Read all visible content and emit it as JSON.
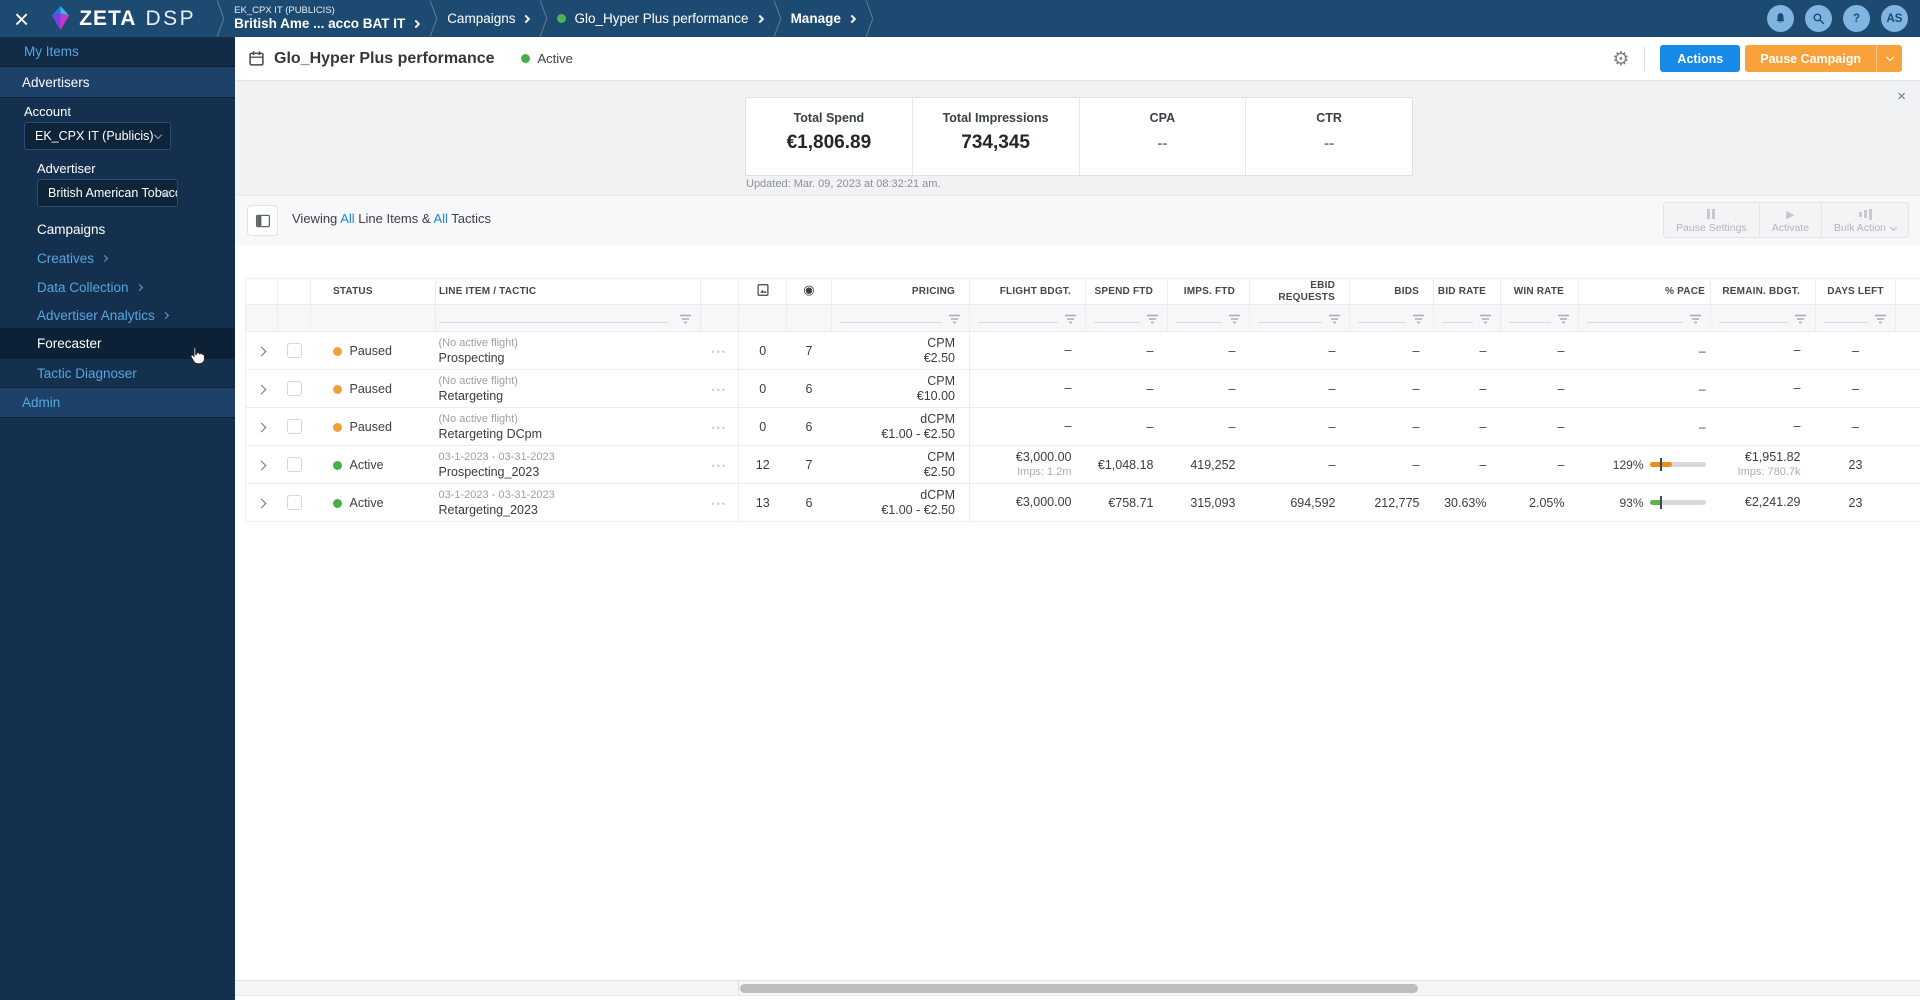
{
  "colors": {
    "accent_blue": "#1789e6",
    "accent_orange": "#f9a23b",
    "active_green": "#45b049",
    "paused_orange": "#f0a13e",
    "navbar_navy": "#1d4a70"
  },
  "status_colors": {
    "paused": "#f0a13e",
    "active": "#45b049"
  },
  "icons": {
    "dots": "•••",
    "gear": "⚙",
    "play": "▶",
    "target": "◉",
    "close": "×",
    "banner_close": "×",
    "help": "?"
  },
  "navbar": {
    "brand": {
      "zeta": "ZETA",
      "dsp": "DSP"
    },
    "breadcrumbs": [
      {
        "eyebrow": "EK_CPX IT (PUBLICIS)",
        "label": "British Ame ... acco BAT IT"
      },
      {
        "label": "Campaigns"
      },
      {
        "label": "Glo_Hyper Plus performance"
      },
      {
        "label": "Manage"
      }
    ],
    "avatar": "AS"
  },
  "sidebar": {
    "my_items": "My Items",
    "advertisers": "Advertisers",
    "account_label": "Account",
    "account_value": "EK_CPX IT (Publicis)",
    "advertiser_label": "Advertiser",
    "advertiser_value": "British American Tobacco B...",
    "campaigns": "Campaigns",
    "creatives": "Creatives",
    "data_collection": "Data Collection",
    "advertiser_analytics": "Advertiser Analytics",
    "forecaster": "Forecaster",
    "tactic_diagnoser": "Tactic Diagnoser",
    "admin": "Admin"
  },
  "header": {
    "title": "Glo_Hyper Plus performance",
    "status": "Active",
    "actions": "Actions",
    "pause_campaign": "Pause Campaign"
  },
  "stats": {
    "items": [
      {
        "label": "Total Spend",
        "value": "€1,806.89"
      },
      {
        "label": "Total Impressions",
        "value": "734,345"
      },
      {
        "label": "CPA",
        "value": "--"
      },
      {
        "label": "CTR",
        "value": "--"
      }
    ],
    "updated": "Updated: Mar. 09, 2023 at 08:32:21 am."
  },
  "toolbar": {
    "viewing_prefix": "Viewing",
    "all_1": "All",
    "mid": "Line Items &",
    "all_2": "All",
    "suffix": "Tactics",
    "pause_settings": "Pause Settings",
    "activate": "Activate",
    "bulk_action": "Bulk Action"
  },
  "table": {
    "headers": {
      "status": "STATUS",
      "line_item": "LINE ITEM / TACTIC",
      "pricing": "PRICING",
      "flight_bdgt": "FLIGHT BDGT.",
      "spend_ftd": "SPEND FTD",
      "imps_ftd": "IMPS. FTD",
      "ebid_requests": "EBID REQUESTS",
      "bids": "BIDS",
      "bid_rate": "BID RATE",
      "win_rate": "WIN RATE",
      "pace": "% PACE",
      "remain_bdgt": "REMAIN. BDGT.",
      "days_left": "DAYS LEFT"
    },
    "icon_columns": [
      "creative-image-icon",
      "tactic-target-icon"
    ],
    "rows": [
      {
        "state": "paused",
        "status": "Paused",
        "flight": "(No active flight)",
        "name": "Prospecting",
        "creatives": "0",
        "tactics": "7",
        "pricing_type": "CPM",
        "pricing_value": "€2.50",
        "flight_bdgt": "–",
        "flight_bdgt_sub": "",
        "spend_ftd": "–",
        "imps_ftd": "–",
        "ebid_requests": "–",
        "bids": "–",
        "bid_rate": "–",
        "win_rate": "–",
        "pace": "–",
        "pace_fill": 0,
        "pace_color": "",
        "remain_bdgt": "–",
        "remain_bdgt_sub": "",
        "days_left": "–"
      },
      {
        "state": "paused",
        "status": "Paused",
        "flight": "(No active flight)",
        "name": "Retargeting",
        "creatives": "0",
        "tactics": "6",
        "pricing_type": "CPM",
        "pricing_value": "€10.00",
        "flight_bdgt": "–",
        "flight_bdgt_sub": "",
        "spend_ftd": "–",
        "imps_ftd": "–",
        "ebid_requests": "–",
        "bids": "–",
        "bid_rate": "–",
        "win_rate": "–",
        "pace": "–",
        "pace_fill": 0,
        "pace_color": "",
        "remain_bdgt": "–",
        "remain_bdgt_sub": "",
        "days_left": "–"
      },
      {
        "state": "paused",
        "status": "Paused",
        "flight": "(No active flight)",
        "name": "Retargeting DCpm",
        "creatives": "0",
        "tactics": "6",
        "pricing_type": "dCPM",
        "pricing_value": "€1.00 - €2.50",
        "flight_bdgt": "–",
        "flight_bdgt_sub": "",
        "spend_ftd": "–",
        "imps_ftd": "–",
        "ebid_requests": "–",
        "bids": "–",
        "bid_rate": "–",
        "win_rate": "–",
        "pace": "–",
        "pace_fill": 0,
        "pace_color": "",
        "remain_bdgt": "–",
        "remain_bdgt_sub": "",
        "days_left": "–"
      },
      {
        "state": "active",
        "status": "Active",
        "flight": "03-1-2023 - 03-31-2023",
        "name": "Prospecting_2023",
        "creatives": "12",
        "tactics": "7",
        "pricing_type": "CPM",
        "pricing_value": "€2.50",
        "flight_bdgt": "€3,000.00",
        "flight_bdgt_sub": "Imps: 1.2m",
        "spend_ftd": "€1,048.18",
        "imps_ftd": "419,252",
        "ebid_requests": "–",
        "bids": "–",
        "bid_rate": "–",
        "win_rate": "–",
        "pace": "129%",
        "pace_fill": 22,
        "pace_color": "#ee8c1e",
        "remain_bdgt": "€1,951.82",
        "remain_bdgt_sub": "Imps: 780.7k",
        "days_left": "23"
      },
      {
        "state": "active",
        "status": "Active",
        "flight": "03-1-2023 - 03-31-2023",
        "name": "Retargeting_2023",
        "creatives": "13",
        "tactics": "6",
        "pricing_type": "dCPM",
        "pricing_value": "€1.00 - €2.50",
        "flight_bdgt": "€3,000.00",
        "flight_bdgt_sub": "",
        "spend_ftd": "€758.71",
        "imps_ftd": "315,093",
        "ebid_requests": "694,592",
        "bids": "212,775",
        "bid_rate": "30.63%",
        "win_rate": "2.05%",
        "pace": "93%",
        "pace_fill": 12,
        "pace_color": "#5cb44e",
        "remain_bdgt": "€2,241.29",
        "remain_bdgt_sub": "",
        "days_left": "23"
      }
    ]
  }
}
